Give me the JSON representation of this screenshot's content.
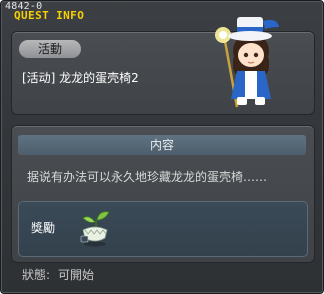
{
  "window": {
    "quest_id": "4842-0",
    "title": "QUEST INFO"
  },
  "quest": {
    "category": "活動",
    "name": "[活动] 龙龙的蛋壳椅2"
  },
  "content": {
    "header": "内容",
    "description": "据说有办法可以永久地珍藏龙龙的蛋壳椅……"
  },
  "reward": {
    "label": "獎勵",
    "item_icon": "egg-chair-icon"
  },
  "status": {
    "label": "狀態:",
    "value": "可開始"
  },
  "npc": {
    "icon": "npc-character"
  }
}
